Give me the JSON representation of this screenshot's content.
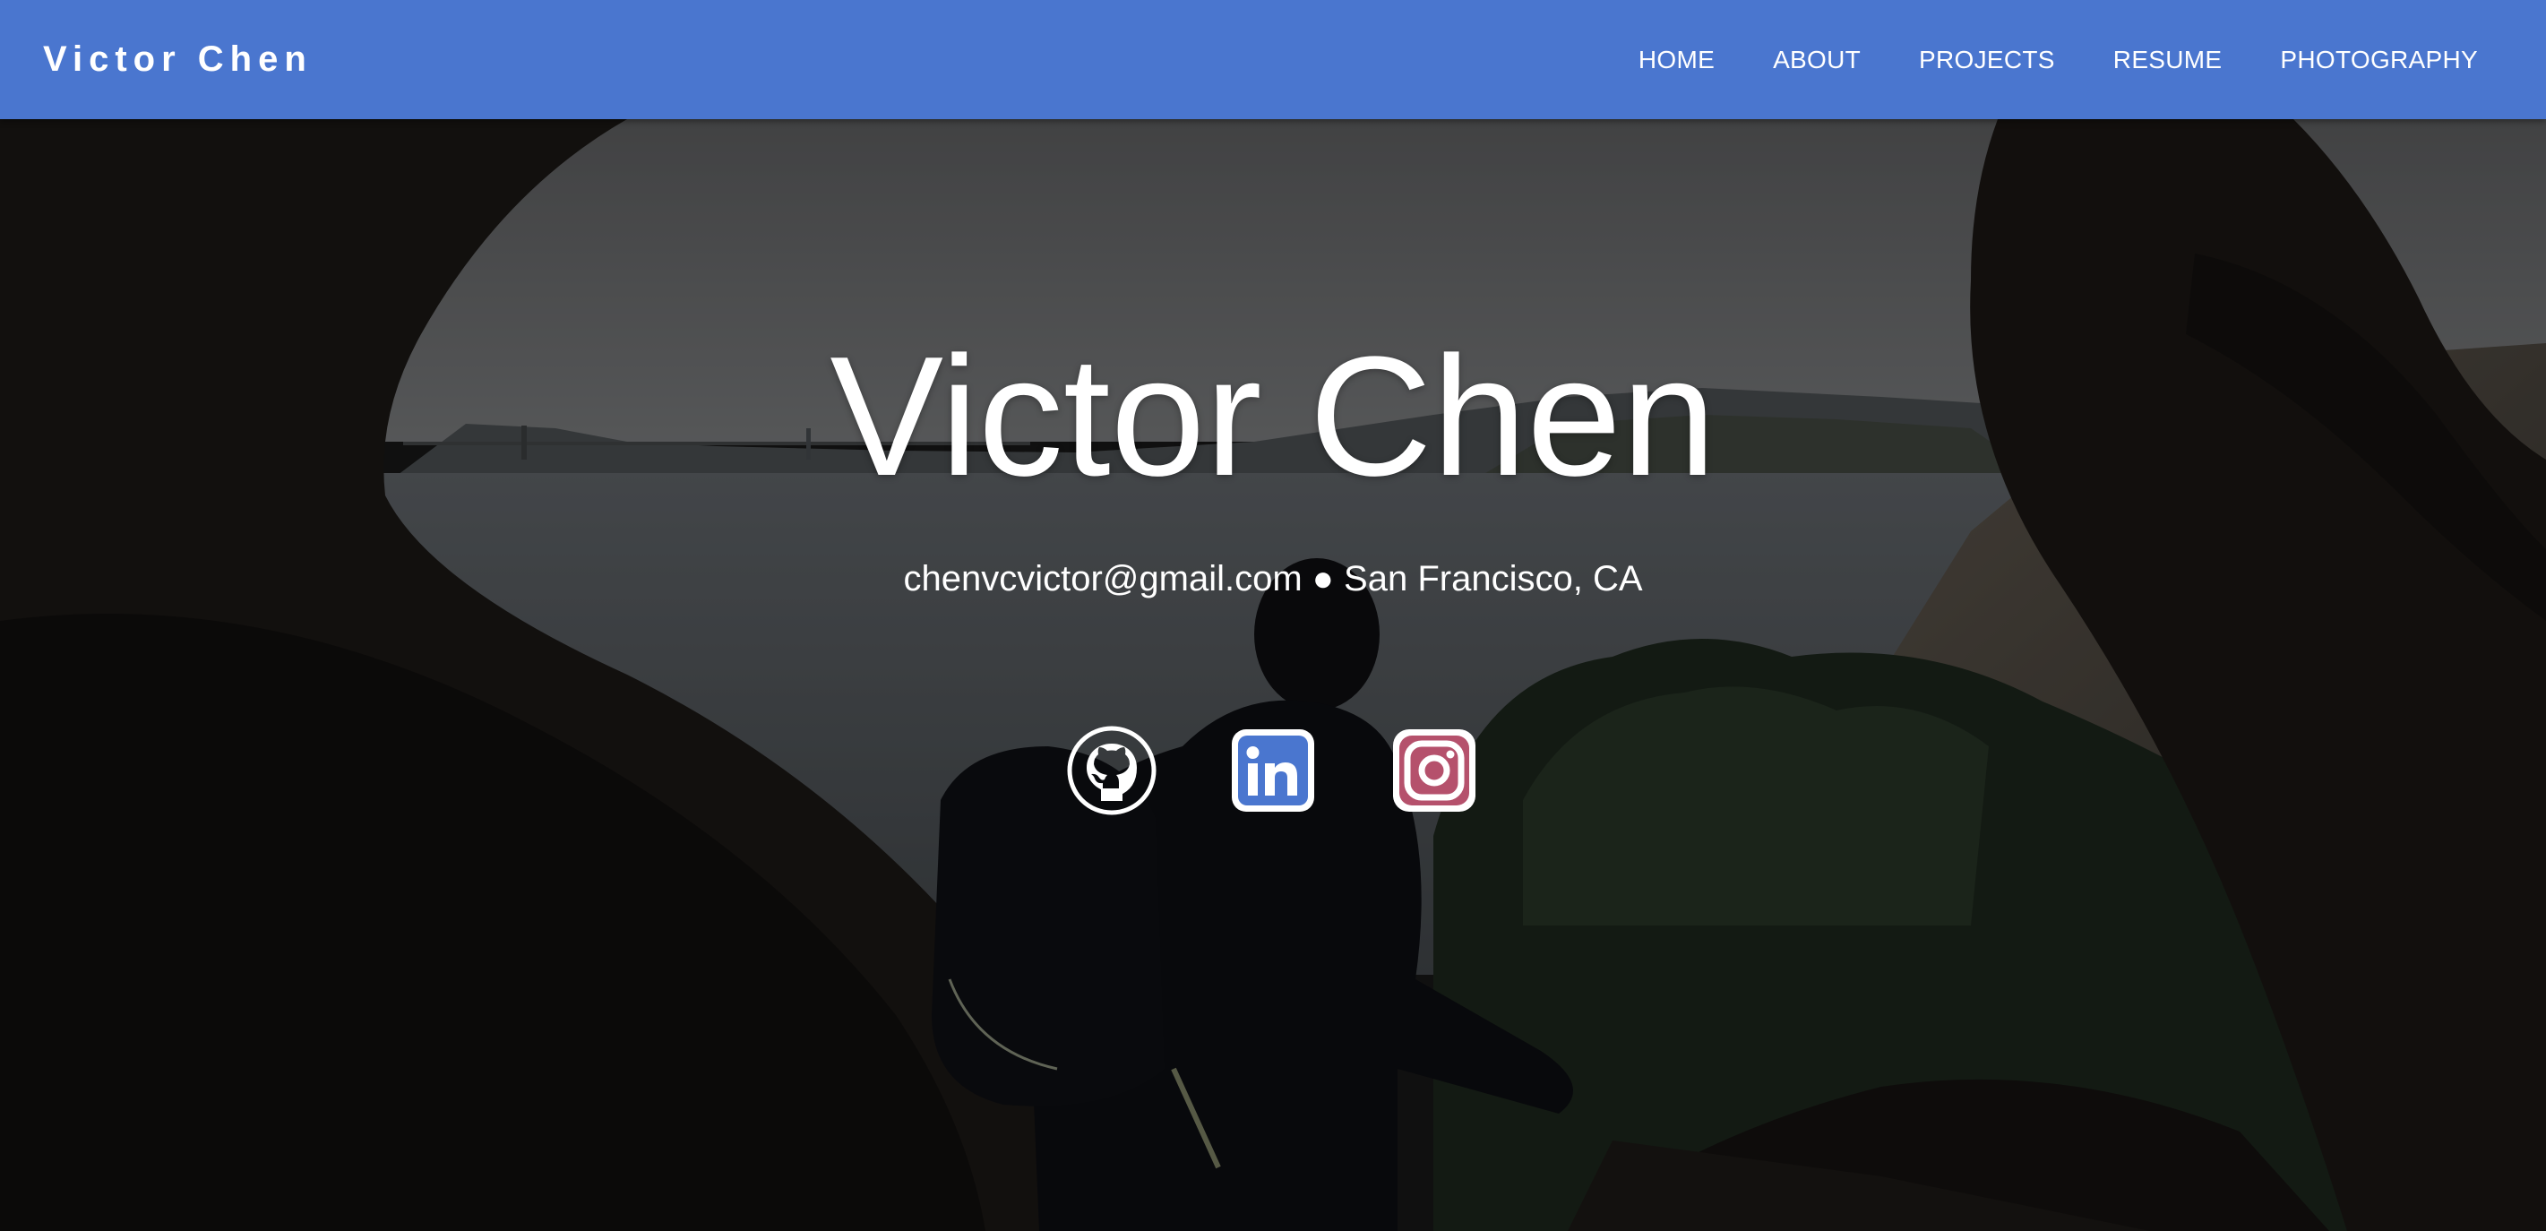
{
  "navbar": {
    "brand": "Victor Chen",
    "links": [
      {
        "label": "HOME"
      },
      {
        "label": "ABOUT"
      },
      {
        "label": "PROJECTS"
      },
      {
        "label": "RESUME"
      },
      {
        "label": "PHOTOGRAPHY"
      }
    ],
    "background_color": "#4a76cf"
  },
  "hero": {
    "title": "Victor Chen",
    "subtitle": "chenvcvictor@gmail.com ● San Francisco, CA",
    "social": [
      {
        "icon": "github-icon"
      },
      {
        "icon": "linkedin-icon"
      },
      {
        "icon": "instagram-icon"
      }
    ],
    "colors": {
      "linkedin": "#4a76cf",
      "instagram": "#b5516c"
    }
  }
}
